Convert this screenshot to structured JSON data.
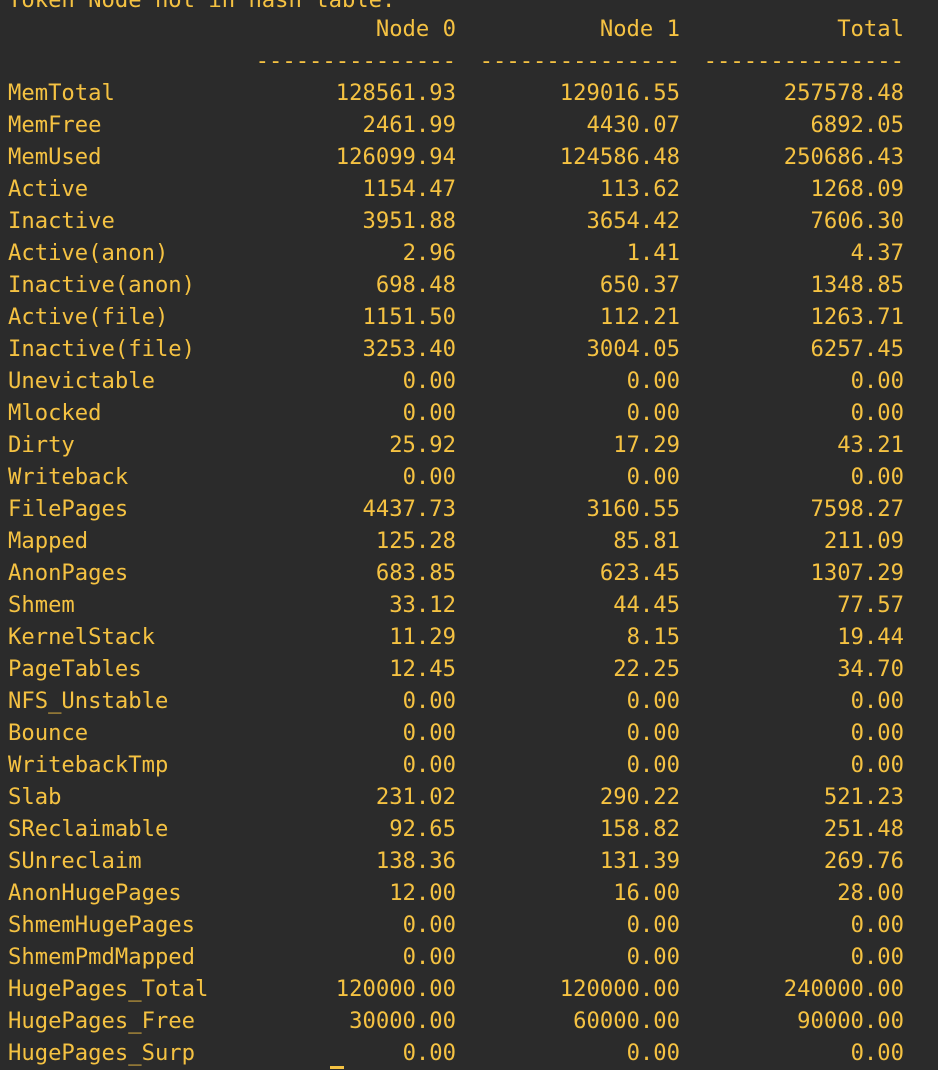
{
  "terminal": {
    "cut_line": "Token Node not in hash table.",
    "header": {
      "label": "",
      "node0": "Node 0",
      "node1": "Node 1",
      "total": "Total"
    },
    "separator": {
      "node0": "---------------",
      "node1": "---------------",
      "total": "---------------"
    },
    "rows": [
      {
        "label": "MemTotal",
        "node0": "128561.93",
        "node1": "129016.55",
        "total": "257578.48"
      },
      {
        "label": "MemFree",
        "node0": "2461.99",
        "node1": "4430.07",
        "total": "6892.05"
      },
      {
        "label": "MemUsed",
        "node0": "126099.94",
        "node1": "124586.48",
        "total": "250686.43"
      },
      {
        "label": "Active",
        "node0": "1154.47",
        "node1": "113.62",
        "total": "1268.09"
      },
      {
        "label": "Inactive",
        "node0": "3951.88",
        "node1": "3654.42",
        "total": "7606.30"
      },
      {
        "label": "Active(anon)",
        "node0": "2.96",
        "node1": "1.41",
        "total": "4.37"
      },
      {
        "label": "Inactive(anon)",
        "node0": "698.48",
        "node1": "650.37",
        "total": "1348.85"
      },
      {
        "label": "Active(file)",
        "node0": "1151.50",
        "node1": "112.21",
        "total": "1263.71"
      },
      {
        "label": "Inactive(file)",
        "node0": "3253.40",
        "node1": "3004.05",
        "total": "6257.45"
      },
      {
        "label": "Unevictable",
        "node0": "0.00",
        "node1": "0.00",
        "total": "0.00"
      },
      {
        "label": "Mlocked",
        "node0": "0.00",
        "node1": "0.00",
        "total": "0.00"
      },
      {
        "label": "Dirty",
        "node0": "25.92",
        "node1": "17.29",
        "total": "43.21"
      },
      {
        "label": "Writeback",
        "node0": "0.00",
        "node1": "0.00",
        "total": "0.00"
      },
      {
        "label": "FilePages",
        "node0": "4437.73",
        "node1": "3160.55",
        "total": "7598.27"
      },
      {
        "label": "Mapped",
        "node0": "125.28",
        "node1": "85.81",
        "total": "211.09"
      },
      {
        "label": "AnonPages",
        "node0": "683.85",
        "node1": "623.45",
        "total": "1307.29"
      },
      {
        "label": "Shmem",
        "node0": "33.12",
        "node1": "44.45",
        "total": "77.57"
      },
      {
        "label": "KernelStack",
        "node0": "11.29",
        "node1": "8.15",
        "total": "19.44"
      },
      {
        "label": "PageTables",
        "node0": "12.45",
        "node1": "22.25",
        "total": "34.70"
      },
      {
        "label": "NFS_Unstable",
        "node0": "0.00",
        "node1": "0.00",
        "total": "0.00"
      },
      {
        "label": "Bounce",
        "node0": "0.00",
        "node1": "0.00",
        "total": "0.00"
      },
      {
        "label": "WritebackTmp",
        "node0": "0.00",
        "node1": "0.00",
        "total": "0.00"
      },
      {
        "label": "Slab",
        "node0": "231.02",
        "node1": "290.22",
        "total": "521.23"
      },
      {
        "label": "SReclaimable",
        "node0": "92.65",
        "node1": "158.82",
        "total": "251.48"
      },
      {
        "label": "SUnreclaim",
        "node0": "138.36",
        "node1": "131.39",
        "total": "269.76"
      },
      {
        "label": "AnonHugePages",
        "node0": "12.00",
        "node1": "16.00",
        "total": "28.00"
      },
      {
        "label": "ShmemHugePages",
        "node0": "0.00",
        "node1": "0.00",
        "total": "0.00"
      },
      {
        "label": "ShmemPmdMapped",
        "node0": "0.00",
        "node1": "0.00",
        "total": "0.00"
      },
      {
        "label": "HugePages_Total",
        "node0": "120000.00",
        "node1": "120000.00",
        "total": "240000.00"
      },
      {
        "label": "HugePages_Free",
        "node0": "30000.00",
        "node1": "60000.00",
        "total": "90000.00"
      },
      {
        "label": "HugePages_Surp",
        "node0": "0.00",
        "node1": "0.00",
        "total": "0.00"
      }
    ]
  },
  "colors": {
    "background": "#2b2b2b",
    "text": "#f5c242"
  }
}
